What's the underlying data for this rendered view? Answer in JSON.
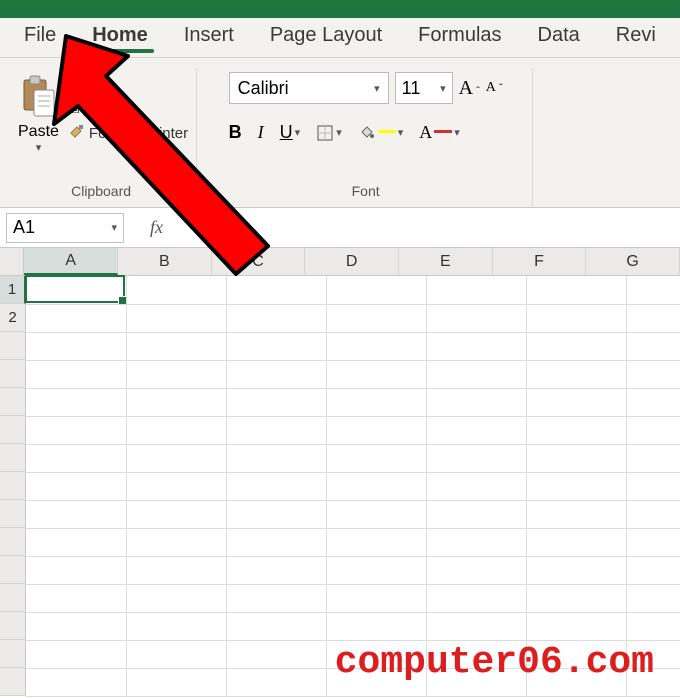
{
  "title_bar": {
    "color": "#217346"
  },
  "tabs": {
    "file": "File",
    "home": "Home",
    "insert": "Insert",
    "page_layout": "Page Layout",
    "formulas": "Formulas",
    "data": "Data",
    "review": "Revi"
  },
  "clipboard": {
    "paste_label": "Paste",
    "copy_label": "y",
    "format_painter_label": "Format Painter",
    "group_label": "Clipboard"
  },
  "font": {
    "name_value": "Calibri",
    "size_value": "11",
    "increase_label": "A",
    "decrease_label": "A",
    "bold_label": "B",
    "italic_label": "I",
    "underline_label": "U",
    "font_color_letter": "A",
    "group_label": "Font",
    "highlight_color": "#ffff00",
    "font_color": "#d13030"
  },
  "name_box": {
    "value": "A1"
  },
  "formula_bar": {
    "fx_label": "fx",
    "value": ""
  },
  "columns": [
    "A",
    "B",
    "C",
    "D",
    "E",
    "F",
    "G"
  ],
  "rows": [
    "1",
    "2"
  ],
  "selection": {
    "col": 0,
    "row": 0
  },
  "watermark": "computer06.com"
}
